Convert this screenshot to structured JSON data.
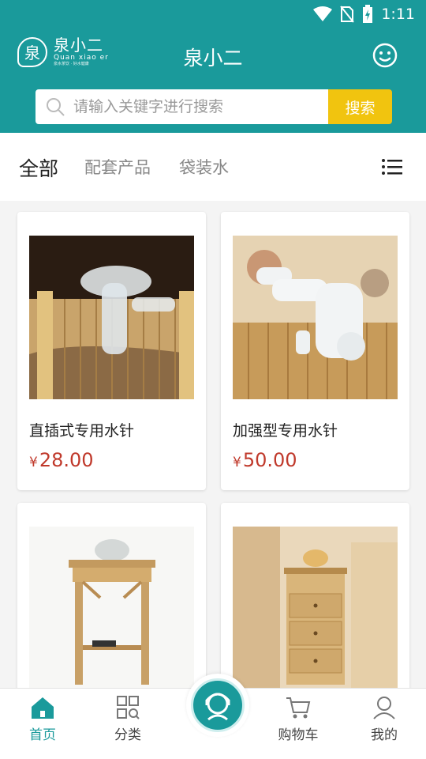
{
  "status_bar": {
    "time": "1:11"
  },
  "header": {
    "logo": {
      "mark": "泉",
      "cn": "泉小二",
      "en": "Quan xiao er",
      "sub": "泉水茶饮 · 好水健康"
    },
    "title": "泉小二",
    "icon": "smile-icon"
  },
  "search": {
    "placeholder": "请输入关键字进行搜索",
    "button_label": "搜索"
  },
  "tabs": [
    {
      "label": "全部",
      "active": true
    },
    {
      "label": "配套产品",
      "active": false
    },
    {
      "label": "袋装水",
      "active": false
    }
  ],
  "products": [
    {
      "name": "直插式专用水针",
      "currency": "¥",
      "price": "28.00",
      "image": "clear-water-needle-on-bamboo-mat"
    },
    {
      "name": "加强型专用水针",
      "currency": "¥",
      "price": "50.00",
      "image": "white-water-needle-on-bamboo-mat"
    },
    {
      "name": "",
      "currency": "",
      "price": "",
      "image": "bamboo-tea-stand-with-kettle"
    },
    {
      "name": "",
      "currency": "",
      "price": "",
      "image": "bamboo-drawer-cabinet-with-kettle"
    }
  ],
  "bottom_nav": [
    {
      "label": "首页",
      "icon": "home-icon",
      "active": true
    },
    {
      "label": "分类",
      "icon": "category-grid-icon",
      "active": false
    },
    {
      "label": "",
      "icon": "customer-service-icon",
      "active": false
    },
    {
      "label": "购物车",
      "icon": "cart-icon",
      "active": false
    },
    {
      "label": "我的",
      "icon": "user-icon",
      "active": false
    }
  ],
  "colors": {
    "primary": "#1a9a9b",
    "accent": "#f1c40f",
    "price": "#c0392b"
  }
}
